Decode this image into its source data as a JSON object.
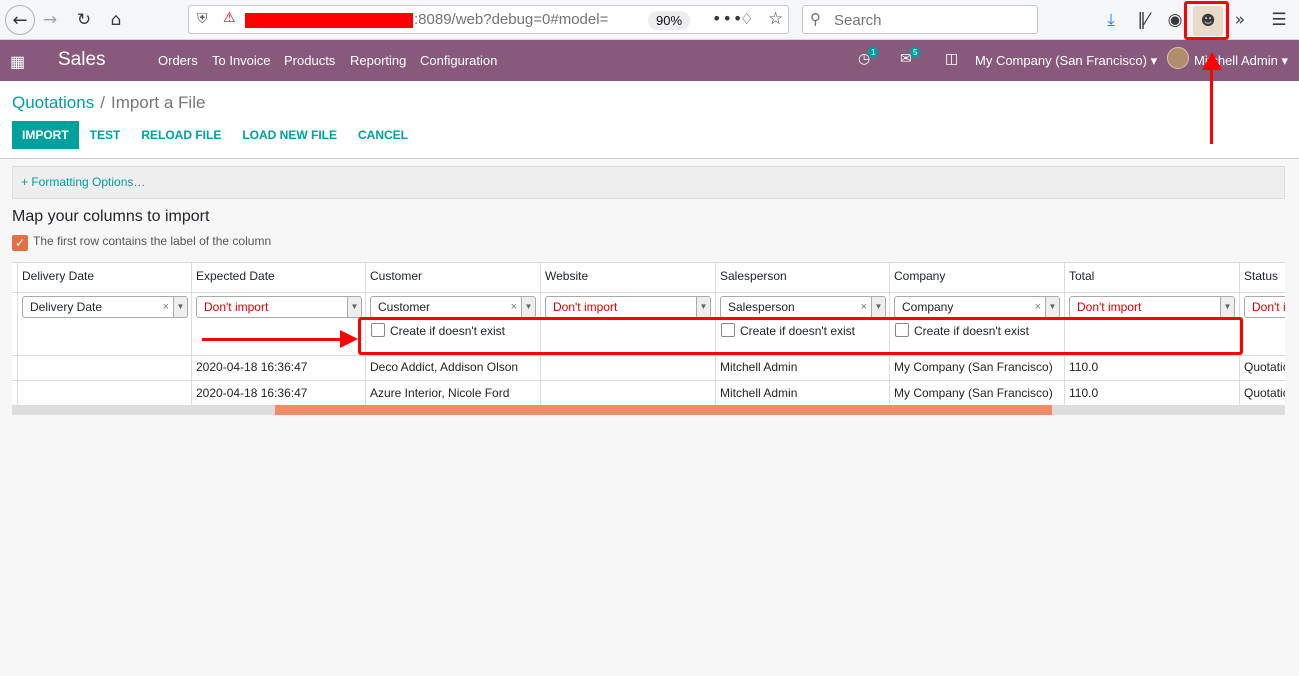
{
  "browser": {
    "url_visible": ":8089/web?debug=0#model=",
    "zoom": "90%",
    "search_placeholder": "Search",
    "back_icon": "back-arrow-icon",
    "forward_icon": "forward-arrow-icon",
    "reload_icon": "reload-icon",
    "home_icon": "home-icon"
  },
  "navbar": {
    "brand": "Sales",
    "menu": [
      "Orders",
      "To Invoice",
      "Products",
      "Reporting",
      "Configuration"
    ],
    "activity_count": "1",
    "messages_count": "5",
    "company": "My Company (San Francisco)",
    "user": "Mitchell Admin"
  },
  "breadcrumb": {
    "parent": "Quotations",
    "separator": "/",
    "current": "Import a File"
  },
  "buttons": {
    "import": "Import",
    "test": "Test",
    "reload": "Reload File",
    "load_new": "Load New File",
    "cancel": "Cancel"
  },
  "formatting": "+ Formatting Options…",
  "map_title": "Map your columns to import",
  "first_row_label": "The first row contains the label of the column",
  "columns": [
    {
      "header": "Delivery Date",
      "field": "Delivery Date",
      "dont_import": false,
      "removable": true,
      "create_option": "",
      "rows": [
        "",
        ""
      ]
    },
    {
      "header": "Expected Date",
      "field": "Don't import",
      "dont_import": true,
      "removable": false,
      "create_option": "",
      "rows": [
        "2020-04-18 16:36:47",
        "2020-04-18 16:36:47"
      ]
    },
    {
      "header": "Customer",
      "field": "Customer",
      "dont_import": false,
      "removable": true,
      "create_option": "Create if doesn't exist",
      "rows": [
        "Deco Addict, Addison Olson",
        "Azure Interior, Nicole Ford"
      ]
    },
    {
      "header": "Website",
      "field": "Don't import",
      "dont_import": true,
      "removable": false,
      "create_option": "",
      "rows": [
        "",
        ""
      ]
    },
    {
      "header": "Salesperson",
      "field": "Salesperson",
      "dont_import": false,
      "removable": true,
      "create_option": "Create if doesn't exist",
      "rows": [
        "Mitchell Admin",
        "Mitchell Admin"
      ]
    },
    {
      "header": "Company",
      "field": "Company",
      "dont_import": false,
      "removable": true,
      "create_option": "Create if doesn't exist",
      "rows": [
        "My Company (San Francisco)",
        "My Company (San Francisco)"
      ]
    },
    {
      "header": "Total",
      "field": "Don't import",
      "dont_import": true,
      "removable": false,
      "create_option": "",
      "rows": [
        "110.0",
        "110.0"
      ]
    },
    {
      "header": "Status",
      "field": "Don't import",
      "dont_import": true,
      "removable": false,
      "create_option": "",
      "rows": [
        "Quotation",
        "Quotation"
      ]
    }
  ],
  "colors": {
    "navbar": "#875a7b",
    "accent": "#00a09d",
    "annotation": "#ff0000",
    "scroll_thumb": "#ef8c68"
  }
}
